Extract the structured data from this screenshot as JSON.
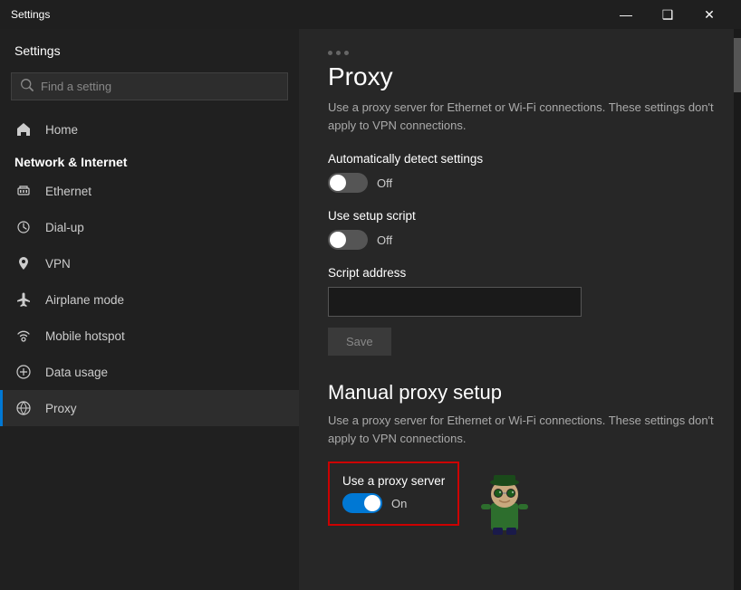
{
  "titleBar": {
    "title": "Settings",
    "minimize": "—",
    "maximize": "❑",
    "close": "✕"
  },
  "sidebar": {
    "header": "Settings",
    "search": {
      "placeholder": "Find a setting"
    },
    "sectionLabel": "Network & Internet",
    "navItems": [
      {
        "id": "home",
        "label": "Home",
        "icon": "home"
      },
      {
        "id": "ethernet",
        "label": "Ethernet",
        "icon": "ethernet"
      },
      {
        "id": "dialup",
        "label": "Dial-up",
        "icon": "dialup"
      },
      {
        "id": "vpn",
        "label": "VPN",
        "icon": "vpn"
      },
      {
        "id": "airplane",
        "label": "Airplane mode",
        "icon": "airplane"
      },
      {
        "id": "hotspot",
        "label": "Mobile hotspot",
        "icon": "hotspot"
      },
      {
        "id": "datausage",
        "label": "Data usage",
        "icon": "data"
      },
      {
        "id": "proxy",
        "label": "Proxy",
        "icon": "proxy",
        "active": true
      }
    ]
  },
  "content": {
    "pageTitle": "Proxy",
    "autoDetectSection": {
      "description": "Use a proxy server for Ethernet or Wi-Fi connections. These settings don't apply to VPN connections.",
      "autoDetectLabel": "Automatically detect settings",
      "autoDetectState": "Off",
      "setupScriptLabel": "Use setup script",
      "setupScriptState": "Off",
      "scriptAddressLabel": "Script address",
      "scriptAddressValue": "",
      "scriptAddressPlaceholder": "",
      "saveLabel": "Save"
    },
    "manualProxySection": {
      "title": "Manual proxy setup",
      "description": "Use a proxy server for Ethernet or Wi-Fi connections. These settings don't apply to VPN connections.",
      "useProxyLabel": "Use a proxy server",
      "useProxyState": "On"
    }
  }
}
